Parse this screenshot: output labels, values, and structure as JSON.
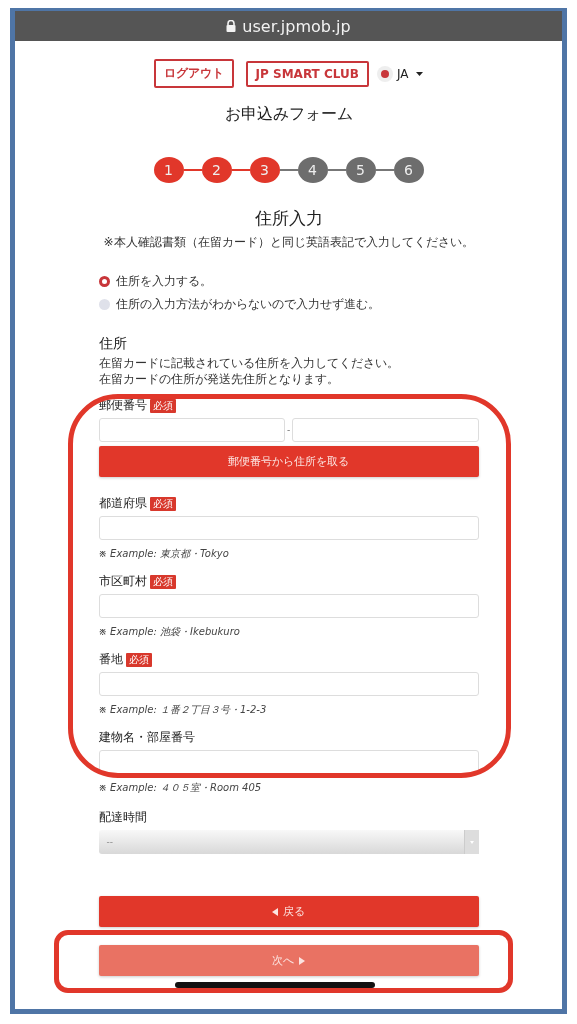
{
  "address_bar": {
    "url": "user.jpmob.jp"
  },
  "header_buttons": [
    {
      "label": "ログアウト"
    },
    {
      "label": "JP SMART CLUB"
    }
  ],
  "language": {
    "label": "JA"
  },
  "form_title": "お申込みフォーム",
  "steps": [
    {
      "label": "1",
      "done": true
    },
    {
      "label": "2",
      "done": true
    },
    {
      "label": "3",
      "done": true
    },
    {
      "label": "4",
      "done": false
    },
    {
      "label": "5",
      "done": false
    },
    {
      "label": "6",
      "done": false
    }
  ],
  "section": {
    "title": "住所入力",
    "note": "※本人確認書類（在留カード）と同じ英語表記で入力してください。"
  },
  "address_options": [
    {
      "label": "住所を入力する。",
      "selected": true
    },
    {
      "label": "住所の入力方法がわからないので入力せず進む。",
      "selected": false
    }
  ],
  "address": {
    "title": "住所",
    "description": [
      "在留カードに記載されている住所を入力してください。",
      "在留カードの住所が発送先住所となります。"
    ]
  },
  "fields": [
    {
      "kind": "postal",
      "label": "郵便番号",
      "required": true,
      "badge": "必須",
      "separator": "-",
      "button": "郵便番号から住所を取る"
    },
    {
      "kind": "text",
      "label": "都道府県",
      "required": true,
      "badge": "必須",
      "hint": "※ Example: 東京都・Tokyo"
    },
    {
      "kind": "text",
      "label": "市区町村",
      "required": true,
      "badge": "必須",
      "hint": "※ Example: 池袋・Ikebukuro"
    },
    {
      "kind": "text",
      "label": "番地",
      "required": true,
      "badge": "必須",
      "hint": "※ Example: １番２丁目３号・1-2-3"
    },
    {
      "kind": "text",
      "label": "建物名・部屋番号",
      "required": false,
      "hint": "※ Example: ４０５室・Room 405"
    },
    {
      "kind": "select",
      "label": "配達時間",
      "required": false,
      "value": "--"
    }
  ],
  "nav_buttons": [
    {
      "label": "戻る",
      "kind": "back",
      "disabled": false
    },
    {
      "label": "次へ",
      "kind": "next",
      "disabled": true
    }
  ]
}
